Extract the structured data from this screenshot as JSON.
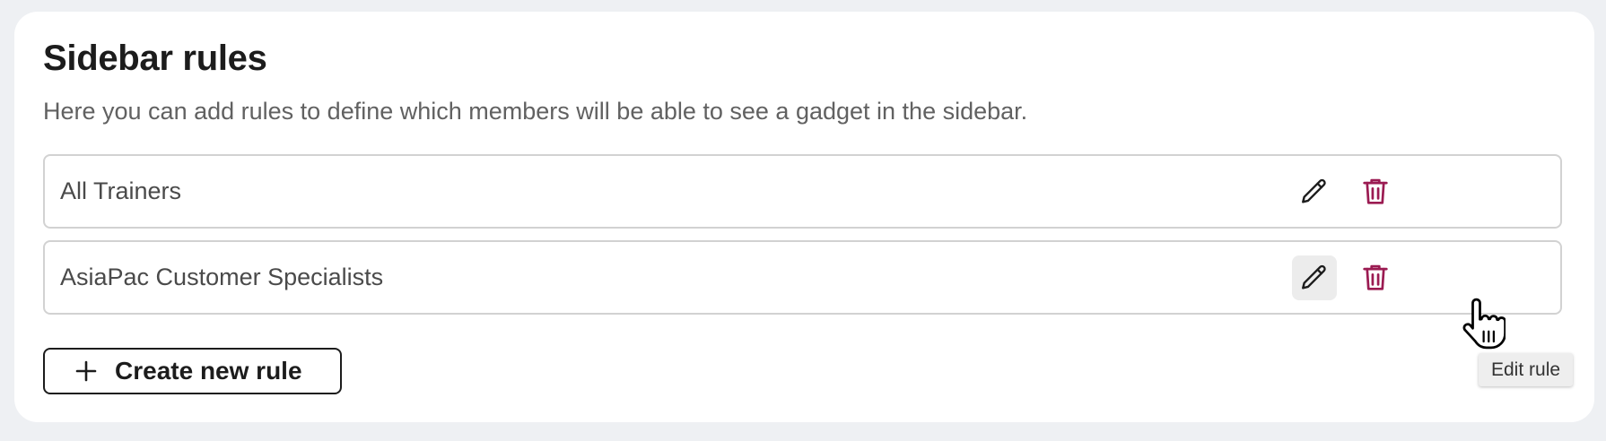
{
  "section": {
    "title": "Sidebar rules",
    "description": "Here you can add rules to define which members will be able to see a gadget in the sidebar."
  },
  "rules": [
    {
      "name": "All Trainers",
      "edit_icon": "pencil-icon",
      "delete_icon": "trash-icon"
    },
    {
      "name": "AsiaPac Customer Specialists",
      "edit_icon": "pencil-icon",
      "delete_icon": "trash-icon"
    }
  ],
  "create_button": {
    "label": "Create new rule",
    "icon": "plus-icon"
  },
  "tooltip": {
    "text": "Edit rule"
  },
  "colors": {
    "background": "#eef0f3",
    "card": "#ffffff",
    "delete_icon": "#9b1b52",
    "text_primary": "#1c1c1c",
    "text_secondary": "#616161"
  }
}
